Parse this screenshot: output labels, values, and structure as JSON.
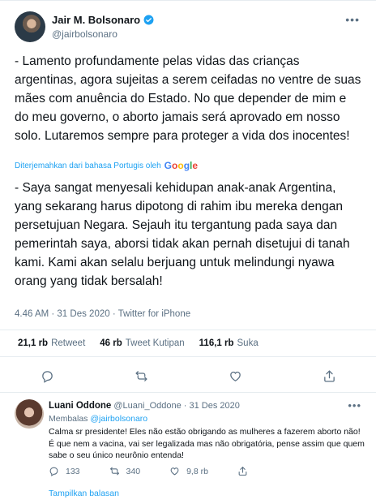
{
  "author": {
    "name": "Jair M. Bolsonaro",
    "handle": "@jairbolsonaro"
  },
  "tweet": {
    "text_original": "- Lamento profundamente pelas vidas das crianças argentinas, agora sujeitas a serem ceifadas no ventre de suas mães com anuência do Estado. No que depender de mim e do meu governo, o aborto jamais será aprovado em nosso solo. Lutaremos sempre para proteger a vida dos inocentes!",
    "translated_label": "Diterjemahkan dari bahasa Portugis oleh",
    "translator": "Google",
    "text_translated": "- Saya sangat menyesali kehidupan anak-anak Argentina, yang sekarang harus dipotong di rahim ibu mereka dengan persetujuan Negara. Sejauh itu tergantung pada saya dan pemerintah saya, aborsi tidak akan pernah disetujui di tanah kami. Kami akan selalu berjuang untuk melindungi nyawa orang yang tidak bersalah!",
    "meta": "4.46 AM · 31 Des 2020 · Twitter for iPhone"
  },
  "stats": {
    "retweets_count": "21,1 rb",
    "retweets_label": "Retweet",
    "quotes_count": "46 rb",
    "quotes_label": "Tweet Kutipan",
    "likes_count": "116,1 rb",
    "likes_label": "Suka"
  },
  "reply": {
    "name": "Luani Oddone",
    "handle": "@Luani_Oddone",
    "date": "· 31 Des 2020",
    "replying_label": "Membalas",
    "replying_to": "@jairbolsonaro",
    "text": "Calma sr presidente! Eles não estão obrigando as mulheres a fazerem aborto não! É que nem a vacina, vai ser legalizada mas não obrigatória, pense assim que quem sabe o seu único neurônio entenda!",
    "reply_count": "133",
    "retweet_count": "340",
    "like_count": "9,8 rb",
    "show_replies": "Tampilkan balasan"
  },
  "colors": {
    "accent": "#1da1f2",
    "secondary_text": "#5b7083",
    "border": "#e6ecf0"
  },
  "icons": [
    "verified-icon",
    "more-icon",
    "reply-icon",
    "retweet-icon",
    "like-icon",
    "share-icon"
  ]
}
